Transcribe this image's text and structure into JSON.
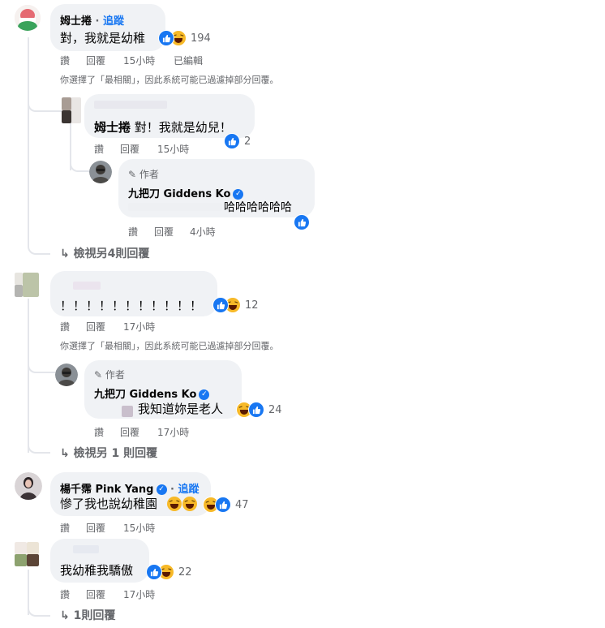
{
  "c1": {
    "name": "姆士捲",
    "dot": "·",
    "follow": "追蹤",
    "text": "對，我就是幼稚",
    "count": "194",
    "actions": {
      "like": "讚",
      "reply": "回覆",
      "time": "15小時",
      "edited": "已編輯"
    },
    "notice": "你選擇了「最相關」，因此系統可能已過濾掉部分回覆。",
    "r1": {
      "mention": "姆士捲",
      "text": "對！我就是幼兒！",
      "count": "2",
      "actions": {
        "like": "讚",
        "reply": "回覆",
        "time": "15小時"
      }
    },
    "r2": {
      "author_badge": "作者",
      "name": "九把刀 Giddens Ko",
      "text": "哈哈哈哈哈哈",
      "actions": {
        "like": "讚",
        "reply": "回覆",
        "time": "4小時"
      }
    },
    "view_more": "檢視另4則回覆"
  },
  "c2": {
    "text": "！！！！！！！！！！！",
    "count": "12",
    "actions": {
      "like": "讚",
      "reply": "回覆",
      "time": "17小時"
    },
    "notice": "你選擇了「最相關」，因此系統可能已過濾掉部分回覆。",
    "r1": {
      "author_badge": "作者",
      "name": "九把刀 Giddens Ko",
      "text": "我知道妳是老人",
      "count": "24",
      "actions": {
        "like": "讚",
        "reply": "回覆",
        "time": "17小時"
      }
    },
    "view_more": "檢視另 1 則回覆"
  },
  "c3": {
    "name": "楊千霈 Pink Yang",
    "dot": "·",
    "follow": "追蹤",
    "text": "慘了我也說幼稚園",
    "count": "47",
    "actions": {
      "like": "讚",
      "reply": "回覆",
      "time": "15小時"
    }
  },
  "c4": {
    "text": "我幼稚我驕傲",
    "count": "22",
    "actions": {
      "like": "讚",
      "reply": "回覆",
      "time": "17小時"
    },
    "view_more": "1則回覆"
  },
  "icons": {
    "reply_arrow": "↳",
    "verified": "✓",
    "pencil": "✎"
  },
  "colors": {
    "link": "#1877f2",
    "bubble": "#f0f2f5",
    "meta": "#65676b",
    "haha": "#f7b928"
  }
}
